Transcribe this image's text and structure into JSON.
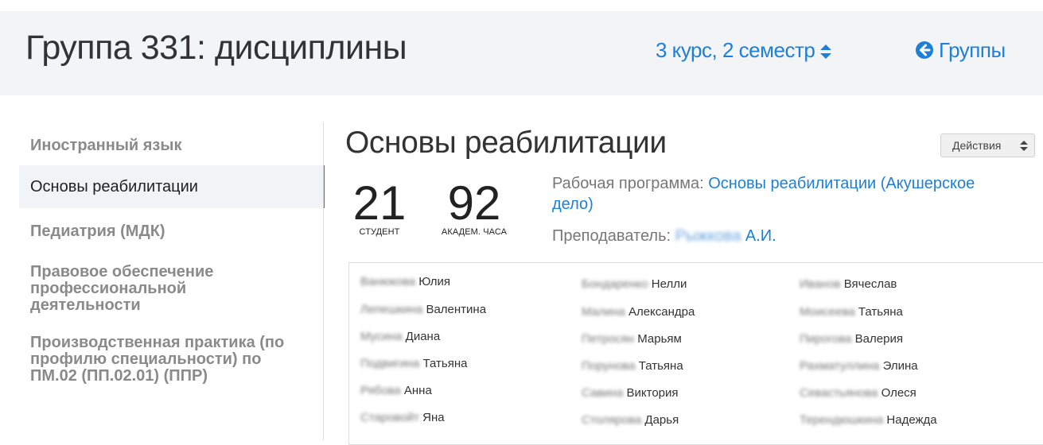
{
  "header": {
    "title": "Группа 331: дисциплины",
    "semester": "3 курс, 2 семестр",
    "groups_link": "Группы"
  },
  "sidebar": {
    "items": [
      {
        "label": "Иностранный язык"
      },
      {
        "label": "Основы реабилитации"
      },
      {
        "label": "Педиатрия (МДК)"
      },
      {
        "label": "Правовое обеспечение профессиональной деятельности"
      },
      {
        "label": "Производственная практика (по профилю специальности) по ПМ.02 (ПП.02.01) (ППР)"
      }
    ]
  },
  "main": {
    "title": "Основы реабилитации",
    "actions_label": "Действия",
    "stats": {
      "students": {
        "value": "21",
        "label": "СТУДЕНТ"
      },
      "hours": {
        "value": "92",
        "label": "АКАДЕМ. ЧАСА"
      }
    },
    "program_label": "Рабочая программа:",
    "program_link": "Основы реабилитации (Акушерское дело)",
    "teacher_label": "Преподаватель:",
    "teacher_surname": "Рыжкова",
    "teacher_initials": "А.И."
  },
  "students": [
    {
      "surname": "Ванюкова",
      "name": "Юлия"
    },
    {
      "surname": "Бондаренко",
      "name": "Нелли"
    },
    {
      "surname": "Иванов",
      "name": "Вячеслав"
    },
    {
      "surname": "Лепешкина",
      "name": "Валентина"
    },
    {
      "surname": "Малина",
      "name": "Александра"
    },
    {
      "surname": "Моисеева",
      "name": "Татьяна"
    },
    {
      "surname": "Мусина",
      "name": "Диана"
    },
    {
      "surname": "Петросян",
      "name": "Марьям"
    },
    {
      "surname": "Пирогова",
      "name": "Валерия"
    },
    {
      "surname": "Подвигина",
      "name": "Татьяна"
    },
    {
      "surname": "Порунова",
      "name": "Татьяна"
    },
    {
      "surname": "Рахматуллина",
      "name": "Элина"
    },
    {
      "surname": "Рябова",
      "name": "Анна"
    },
    {
      "surname": "Савина",
      "name": "Виктория"
    },
    {
      "surname": "Севастьянова",
      "name": "Олеся"
    },
    {
      "surname": "Старовойт",
      "name": "Яна"
    },
    {
      "surname": "Столярова",
      "name": "Дарья"
    },
    {
      "surname": "Терендюшкина",
      "name": "Надежда"
    }
  ],
  "colors": {
    "link": "#1e7fd6",
    "header_bg": "#f3f4f6",
    "active_item_bg": "#f2f3f5"
  },
  "icons": {
    "sort": "sort-updown-icon",
    "back": "circle-arrow-left-icon"
  }
}
